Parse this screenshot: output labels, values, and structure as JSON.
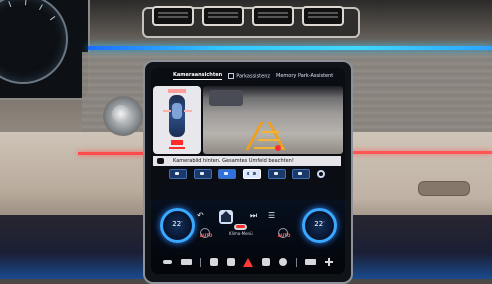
{
  "top_tabs": {
    "camera": "Kameraansichten",
    "park_assist": "Parkassistenz",
    "memory_park": "Memory Park-Assistent"
  },
  "status_message": "Kamerabild hinten. Gesamtes Umfeld beachten!",
  "climate": {
    "left_temp": "22",
    "right_temp": "22",
    "unit": "°",
    "auto_left": "AUTO",
    "auto_right": "AUTO",
    "climate_menu": "Klima-Menü"
  },
  "icons": {
    "warning": "warning-icon",
    "home": "home-icon",
    "settings": "gear-icon"
  }
}
